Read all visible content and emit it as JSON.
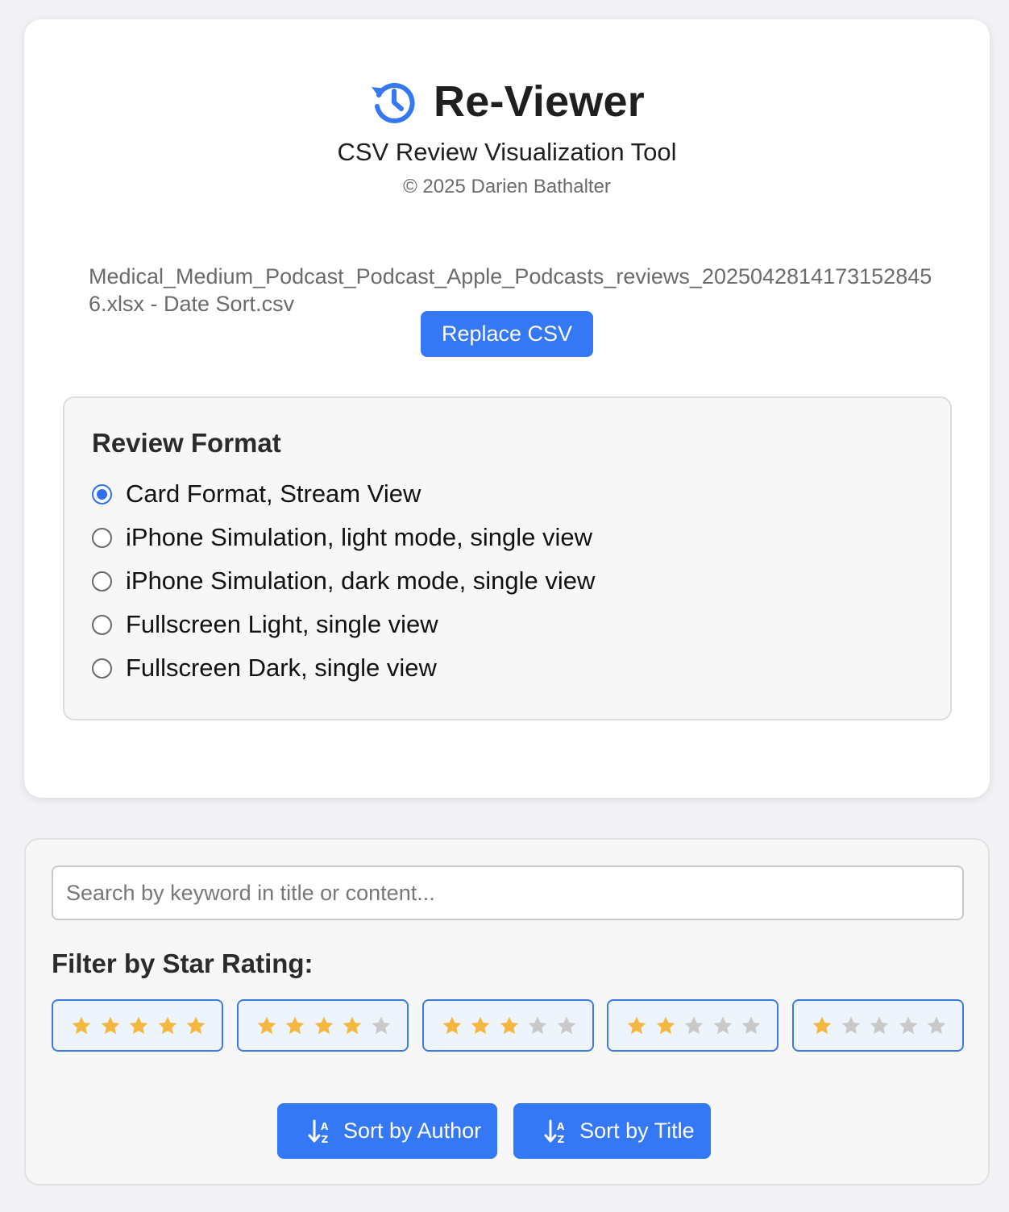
{
  "app": {
    "title": "Re-Viewer",
    "subtitle": "CSV Review Visualization Tool",
    "copyright": "© 2025 Darien Bathalter",
    "logo_icon": "history-clock-icon",
    "accent_color": "#3478f6"
  },
  "file": {
    "name": "Medical_Medium_Podcast_Podcast_Apple_Podcasts_reviews_20250428141731528456.xlsx - Date Sort.csv",
    "replace_label": "Replace CSV"
  },
  "review_format": {
    "title": "Review Format",
    "options": [
      {
        "label": "Card Format, Stream View",
        "selected": true
      },
      {
        "label": "iPhone Simulation, light mode, single view",
        "selected": false
      },
      {
        "label": "iPhone Simulation, dark mode, single view",
        "selected": false
      },
      {
        "label": "Fullscreen Light, single view",
        "selected": false
      },
      {
        "label": "Fullscreen Dark, single view",
        "selected": false
      }
    ]
  },
  "filters": {
    "search_placeholder": "Search by keyword in title or content...",
    "search_value": "",
    "star_filter_title": "Filter by Star Rating:",
    "star_ratings": [
      5,
      4,
      3,
      2,
      1
    ],
    "max_stars": 5,
    "filled_star_color": "#f4b73f",
    "empty_star_color": "#c9c9c9"
  },
  "sort": {
    "author_label": "Sort by Author",
    "title_label": "Sort by Title",
    "icon": "sort-alpha-down-icon"
  }
}
